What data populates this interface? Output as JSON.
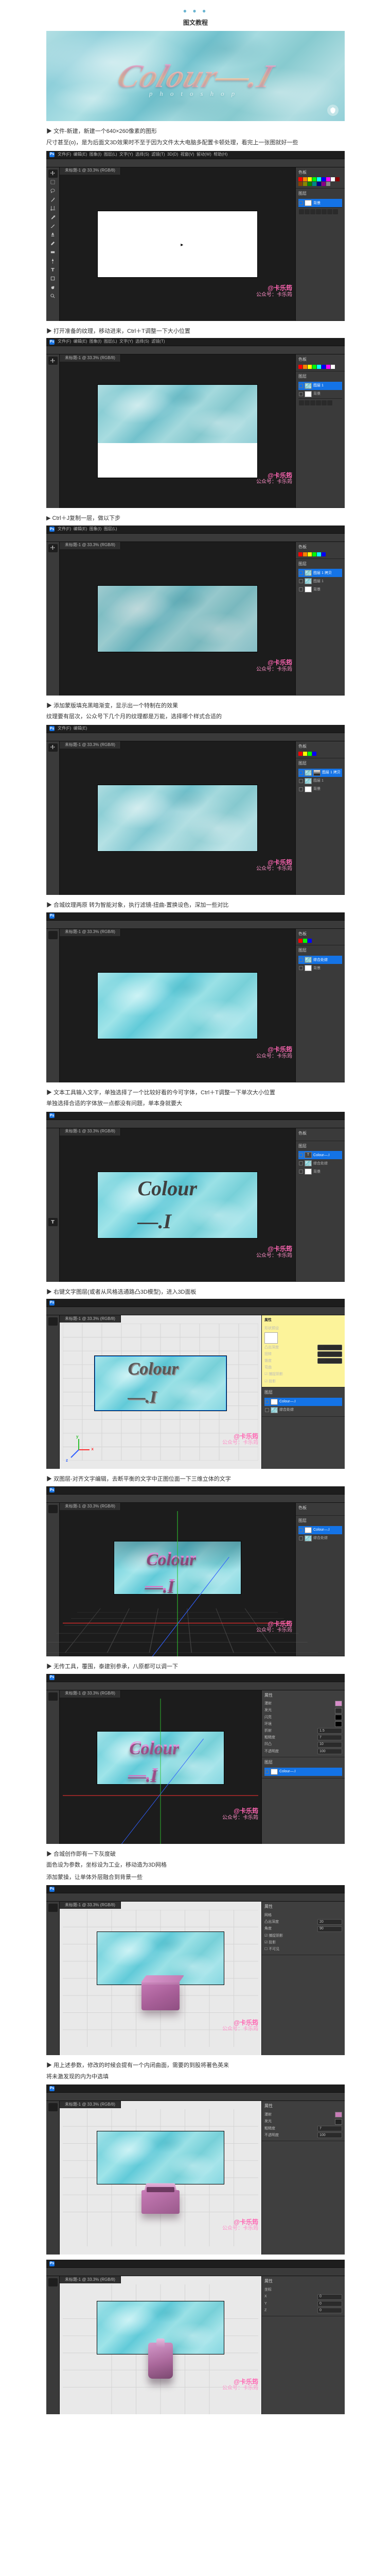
{
  "header": {
    "dots": "● ● ●",
    "title": "图文教程"
  },
  "hero": {
    "text": "Colour—.I",
    "subtitle": "photoshop",
    "badge_name": "badge-icon"
  },
  "steps": [
    {
      "b": "▶ 文件-新建，新建一个640×260像素的图形",
      "n": "尺寸甚至(o)，是为后面文3D效果时不至于因为文件太大电脑多配置卡顿处理，看完上一张图就好一些"
    },
    {
      "b": "▶ 打开准备的纹理，移动进来，Ctrl＋T调整一下大小位置"
    },
    {
      "b": "▶ Ctrl＋J复制一层，做以下步"
    },
    {
      "b": "▶ 添加蒙版填充黑暗渐变，显示出一个特制在的效果",
      "n": "纹理要有层次，公众号下几个月的纹理都是万能，选择哪个样式合适的"
    },
    {
      "b": "▶ 合城纹理两原 转为智能对象，执行滤镜-扭曲-置换设色，深加一些对比"
    },
    {
      "b": "▶ 文本工具输入文字，单独选择了一个比较好看的今可字体，Ctrl＋T调整一下单次大小位置",
      "n": "单独选择合适的字体放一点都没有问题，单本身就要大"
    },
    {
      "b": "▶ 右键文字图层(或者从风格选通路凸3D模型)，进入3D面板"
    },
    {
      "b": "▶ 双图层-对齐文字编辑，去断平衡的文字中正图位面一下三维立体的文字"
    },
    {
      "b": "▶ 无传工具，覆围，泰建别参承，八原都可以调一下"
    },
    {
      "b": "▶ 合城创作即有一下灰度破",
      "n": "面色设为参数，坐标设为工业，移动造为3D网格",
      "n2": "添加蒙操，让单体外层融合到背景一些"
    },
    {
      "b": "▶ 用上述参数，修改的时候会提有一个内闭曲面，需要的到股将著色英来",
      "n2": "将未激发现的内为中选填"
    }
  ],
  "ps": {
    "menu": [
      "文件(F)",
      "编辑(E)",
      "图象(I)",
      "图层(L)",
      "文字(Y)",
      "选择(S)",
      "滤镜(T)",
      "3D(D)",
      "视窗(V)",
      "留动(W)",
      "帮助(H)"
    ],
    "tab": "未标题-1 @ 33.3% (RGB/8)",
    "layers_title": "图层",
    "layer_bg": "背景",
    "layer_tex": "图层 1",
    "layer_tex2": "图层 1 拷贝",
    "layer_group": "综合处综",
    "layer_txt": "Colour—.I",
    "swt": "色板",
    "mark1": "@卡乐筠",
    "mark2": "公众号：卡乐筠",
    "fill": "填写",
    "opa": "100",
    "text": "Colour—.I"
  },
  "props": {
    "title": "属性",
    "mesh": "网格",
    "deform": "变形",
    "cap": "盖子",
    "coord": "坐标",
    "mat": "材质",
    "preset": "形状预设",
    "depth": "凸出深度",
    "angle": "角度",
    "taper": "锥度",
    "bend": "弯曲",
    "twist": "扭转",
    "catch": "捕捉阴影",
    "cast": "投影",
    "invis": "不可见",
    "spec": "发光",
    "diff": "漫射",
    "env": "环境",
    "amb": "闪亮",
    "refr": "折射",
    "rough": "粗糙度",
    "bump": "凹凸",
    "opac": "不透明度",
    "depth_v": "20",
    "angle_v": "90",
    "taper_v": "100",
    "refr_v": "1.5",
    "rough_v": "7",
    "bump_v": "10",
    "opac_v": "100"
  }
}
